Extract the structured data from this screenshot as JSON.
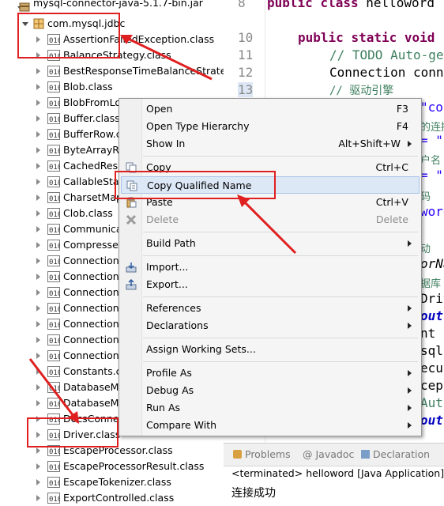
{
  "tree": {
    "jar": "mysql-connector-java-5.1.7-bin.jar",
    "package": "com.mysql.jdbc",
    "classes": [
      "AssertionFailedException.class",
      "BalanceStrategy.class",
      "BestResponseTimeBalanceStrate",
      "Blob.class",
      "BlobFromLo",
      "Buffer.class",
      "BufferRow.c",
      "ByteArrayRo",
      "CachedResu",
      "CallableState",
      "CharsetMap",
      "Clob.class",
      "Communicat",
      "Compressed",
      "Connection.c",
      "ConnectionF",
      "ConnectionI",
      "ConnectionL",
      "ConnectionP",
      "ConnectionF",
      "ConnectionP",
      "Constants.cl",
      "DatabaseMe",
      "DatabaseMe",
      "DocsConnec",
      "Driver.class",
      "EscapeProcessor.class",
      "EscapeProcessorResult.class",
      "EscapeTokenizer.class",
      "ExportControlled.class"
    ]
  },
  "editor": {
    "line_numbers": [
      "8",
      "10",
      "11",
      "12",
      "13"
    ],
    "code": {
      "l8_kw1": "public",
      "l8_kw2": "class",
      "l8_name": "helloword",
      "l10_kw1": "public",
      "l10_kw2": "static",
      "l10_kw3": "void",
      "l11_todo": "// TODO Auto-ge",
      "l12": "Connection conn",
      "l13": "// 驱动引擎",
      "p1": "\"co",
      "p2": "的连接",
      "p3": "= \"j",
      "p4": "户名",
      "p5": "= \"",
      "p6": "码",
      "p7": "word",
      "p8": "动",
      "p9": "orNa",
      "p10": "据库",
      "p11": "Driv",
      "p12": "out.",
      "p13": "nt s",
      "p14": "sql",
      "p15": "ecut",
      "p16": "cept",
      "p17": "Aut",
      "p18": "out."
    }
  },
  "console": {
    "tabs": [
      "Problems",
      "Javadoc",
      "Declaration"
    ],
    "terminated": "<terminated> helloword [Java Application] C:\\",
    "output": "连接成功"
  },
  "menu": {
    "items": [
      {
        "label": "Open",
        "shortcut": "F3"
      },
      {
        "label": "Open Type Hierarchy",
        "shortcut": "F4"
      },
      {
        "label": "Show In",
        "shortcut": "Alt+Shift+W"
      },
      {
        "label": "Copy",
        "shortcut": "Ctrl+C"
      },
      {
        "label": "Copy Qualified Name",
        "shortcut": ""
      },
      {
        "label": "Paste",
        "shortcut": "Ctrl+V"
      },
      {
        "label": "Delete",
        "shortcut": "Delete"
      },
      {
        "label": "Build Path",
        "shortcut": ""
      },
      {
        "label": "Import...",
        "shortcut": ""
      },
      {
        "label": "Export...",
        "shortcut": ""
      },
      {
        "label": "References",
        "shortcut": ""
      },
      {
        "label": "Declarations",
        "shortcut": ""
      },
      {
        "label": "Assign Working Sets...",
        "shortcut": ""
      },
      {
        "label": "Profile As",
        "shortcut": ""
      },
      {
        "label": "Debug As",
        "shortcut": ""
      },
      {
        "label": "Run As",
        "shortcut": ""
      },
      {
        "label": "Compare With",
        "shortcut": ""
      }
    ]
  },
  "colors": {
    "annotation": "#e02020",
    "keyword": "#7f0055",
    "comment": "#3f7f5f",
    "highlight": "#dde8f7"
  }
}
